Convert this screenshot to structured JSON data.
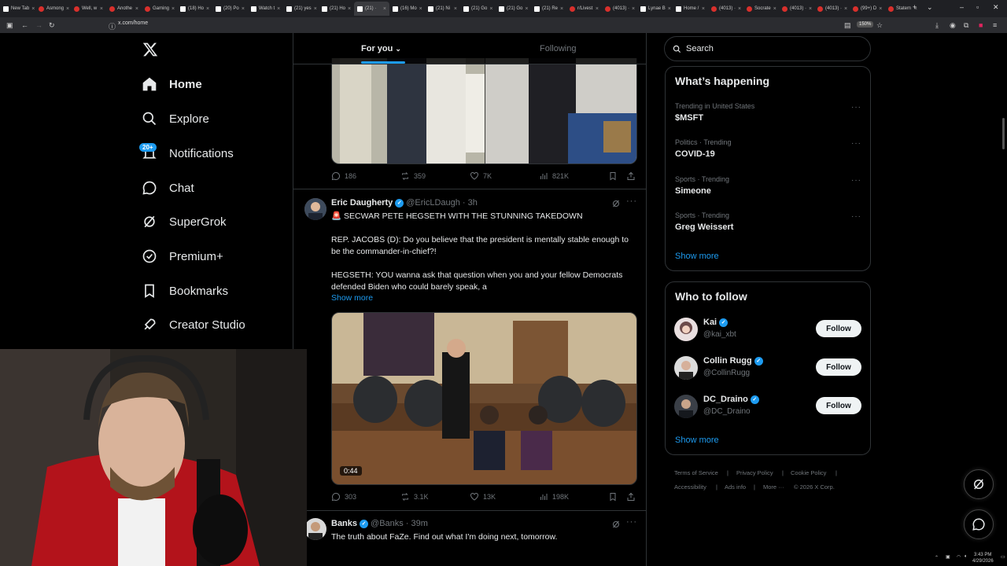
{
  "browser": {
    "tabs": [
      {
        "title": "New Tab",
        "icon": "newtab"
      },
      {
        "title": "Asmong",
        "icon": "yt"
      },
      {
        "title": "Well, w",
        "icon": "yt"
      },
      {
        "title": "Anothe",
        "icon": "yt"
      },
      {
        "title": "Gaming",
        "icon": "yt"
      },
      {
        "title": "(18) Ho",
        "icon": "x"
      },
      {
        "title": "(20) Po",
        "icon": "x"
      },
      {
        "title": "Watch t",
        "icon": "x"
      },
      {
        "title": "(21) yes",
        "icon": "x"
      },
      {
        "title": "(21) Ho",
        "icon": "x"
      },
      {
        "title": "(21) ·",
        "icon": "x",
        "active": true
      },
      {
        "title": "(16) Mo",
        "icon": "x"
      },
      {
        "title": "(21) Ni",
        "icon": "x"
      },
      {
        "title": "(21) Go",
        "icon": "x"
      },
      {
        "title": "(21) Go",
        "icon": "x"
      },
      {
        "title": "(21) Re",
        "icon": "x"
      },
      {
        "title": "r/Livest",
        "icon": "reddit"
      },
      {
        "title": "(4013) ·",
        "icon": "yt"
      },
      {
        "title": "Lynae B",
        "icon": "x"
      },
      {
        "title": "Home /",
        "icon": "x"
      },
      {
        "title": "(4013) ·",
        "icon": "yt"
      },
      {
        "title": "Socrate",
        "icon": "yt"
      },
      {
        "title": "(4013) ·",
        "icon": "yt"
      },
      {
        "title": "(4013) ·",
        "icon": "yt"
      },
      {
        "title": "(99+) D",
        "icon": "other"
      },
      {
        "title": "Statem",
        "icon": "yt"
      }
    ],
    "url": "x.com/home",
    "zoom": "150%"
  },
  "sidebar": {
    "items": [
      {
        "label": "Home",
        "icon": "home-icon",
        "active": true
      },
      {
        "label": "Explore",
        "icon": "search-icon"
      },
      {
        "label": "Notifications",
        "icon": "bell-icon",
        "badge": "20+"
      },
      {
        "label": "Chat",
        "icon": "chat-icon"
      },
      {
        "label": "SuperGrok",
        "icon": "grok-icon"
      },
      {
        "label": "Premium+",
        "icon": "verified-icon"
      },
      {
        "label": "Bookmarks",
        "icon": "bookmark-icon"
      },
      {
        "label": "Creator Studio",
        "icon": "rocket-icon"
      }
    ]
  },
  "feed": {
    "tabs": {
      "for_you": "For you",
      "following": "Following"
    },
    "tweet1": {
      "replies": "186",
      "reposts": "359",
      "likes": "7K",
      "views": "821K"
    },
    "tweet2": {
      "name": "Eric Daugherty",
      "handle": "@EricLDaugh",
      "time": "· 3h",
      "line1": "🚨 SECWAR PETE HEGSETH WITH THE STUNNING TAKEDOWN",
      "line2": "REP. JACOBS (D): Do you believe that the president is mentally stable enough to be the commander-in-chief?!",
      "line3": "HEGSETH: YOU wanna ask that question when you and your fellow Democrats defended Biden who could barely speak, a",
      "show_more": "Show more",
      "video_time": "0:44",
      "replies": "303",
      "reposts": "3.1K",
      "likes": "13K",
      "views": "198K"
    },
    "tweet3": {
      "name": "Banks",
      "handle": "@Banks",
      "time": "· 39m",
      "text": "The truth about FaZe. Find out what I'm doing next, tomorrow."
    }
  },
  "right": {
    "search_placeholder": "Search",
    "whats_happening": {
      "title": "What’s happening",
      "trends": [
        {
          "meta": "Trending in United States",
          "name": "$MSFT"
        },
        {
          "meta": "Politics · Trending",
          "name": "COVID-19"
        },
        {
          "meta": "Sports · Trending",
          "name": "Simeone"
        },
        {
          "meta": "Sports · Trending",
          "name": "Greg Weissert"
        }
      ],
      "show_more": "Show more"
    },
    "who_to_follow": {
      "title": "Who to follow",
      "accounts": [
        {
          "name": "Kai",
          "handle": "@kai_xbt",
          "button": "Follow"
        },
        {
          "name": "Collin Rugg",
          "handle": "@CollinRugg",
          "button": "Follow"
        },
        {
          "name": "DC_Draino",
          "handle": "@DC_Draino",
          "button": "Follow"
        }
      ],
      "show_more": "Show more"
    },
    "footer": {
      "links": [
        "Terms of Service",
        "|",
        "Privacy Policy",
        "|",
        "Cookie Policy",
        "|"
      ],
      "links2": [
        "Accessibility",
        "|",
        "Ads info",
        "|",
        "More ···",
        "© 2026 X Corp."
      ]
    }
  },
  "taskbar": {
    "time": "3:43 PM",
    "date": "4/29/2026"
  },
  "colors": {
    "accent": "#1d9bf0",
    "bg": "#000000",
    "border": "#2f3336",
    "muted": "#71767b"
  }
}
